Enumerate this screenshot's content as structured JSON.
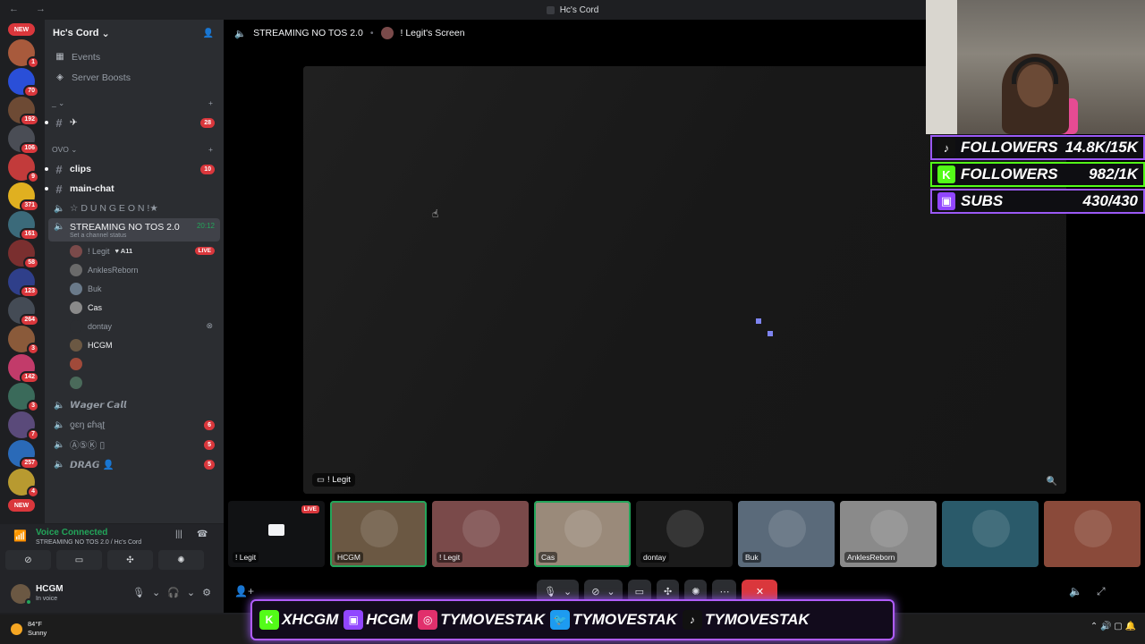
{
  "titlebar": {
    "title": "Hc's Cord",
    "nav": "← →"
  },
  "rail": {
    "new_top": "NEW",
    "new_bottom": "NEW",
    "servers": [
      {
        "badge": "1",
        "color": "#a85a3c"
      },
      {
        "badge": "70",
        "color": "#2a4fd8"
      },
      {
        "badge": "192",
        "color": "#6d4a34"
      },
      {
        "badge": "106",
        "color": "#4a4d55"
      },
      {
        "badge": "9",
        "color": "#c23b3b"
      },
      {
        "badge": "371",
        "color": "#e0b020"
      },
      {
        "badge": "161",
        "color": "#3b6a7a"
      },
      {
        "badge": "58",
        "color": "#7a2f2f"
      },
      {
        "badge": "123",
        "color": "#2f3f8a"
      },
      {
        "badge": "264",
        "color": "#444b55"
      },
      {
        "badge": "3",
        "color": "#8a5a3a"
      },
      {
        "badge": "142",
        "color": "#c23b6a"
      },
      {
        "badge": "3",
        "color": "#3a6a5a"
      },
      {
        "badge": "7",
        "color": "#5a4a7a"
      },
      {
        "badge": "257",
        "color": "#2a6ab8"
      },
      {
        "badge": "4",
        "color": "#b89a30"
      }
    ]
  },
  "sidebar": {
    "guild_name": "Hc's Cord",
    "menu": [
      {
        "label": "Events",
        "icon": "calendar-icon"
      },
      {
        "label": "Server Boosts",
        "icon": "boost-icon"
      }
    ],
    "cat1": "_",
    "chan_plane": {
      "name": "✈",
      "count": "28"
    },
    "cat2": "OVO",
    "channels": [
      {
        "name": "clips",
        "count": "10",
        "bright": true
      },
      {
        "name": "main-chat",
        "bright": true
      },
      {
        "name": "☆ D U N G E O N !★",
        "voice": true
      }
    ],
    "active_channel": {
      "name": "STREAMING NO TOS 2.0",
      "timer": "20:12",
      "status": "Set a channel status"
    },
    "voice_users": [
      {
        "name": "! Legit",
        "extra": "♥ A11",
        "live": "LIVE",
        "color": "#7a4a4a"
      },
      {
        "name": "AnklesReborn",
        "color": "#6a6a6a"
      },
      {
        "name": "Buk",
        "color": "#6a7a8a"
      },
      {
        "name": "Cas",
        "bright": true,
        "color": "#8a8a8a"
      },
      {
        "name": "dontay",
        "xbox": "⊗",
        "color": "#2b2d31"
      },
      {
        "name": "HCGM",
        "bright": true,
        "color": "#6b5843"
      },
      {
        "name": "",
        "color": "#a04a3a"
      },
      {
        "name": "",
        "color": "#4a6a5a"
      }
    ],
    "more_channels": [
      {
        "name": "𝙒𝙖𝙜𝙚𝙧 𝘾𝙖𝙡𝙡"
      },
      {
        "name": "ƍɛŋ ɕɦąʈ",
        "count": "6"
      },
      {
        "name": "Ⓐ⑤Ⓚ ▯",
        "count": "5"
      },
      {
        "name": "𝘿𝙍𝘼𝙂 👤",
        "count": "5"
      }
    ]
  },
  "voice_panel": {
    "status": "Voice Connected",
    "sub": "STREAMING NO TOS 2.0 / Hc's Cord"
  },
  "user_panel": {
    "name": "HCGM",
    "sub": "In voice"
  },
  "call": {
    "header_channel": "STREAMING NO TOS 2.0",
    "header_screen": "! Legit's Screen",
    "stream_label": "! Legit",
    "tiles": [
      {
        "name": "! Legit",
        "live": "LIVE",
        "type": "screen"
      },
      {
        "name": "HCGM",
        "speaking": true,
        "color": "#6b5843"
      },
      {
        "name": "! Legit",
        "color": "#7a4a4a"
      },
      {
        "name": "Cas",
        "speaking": true,
        "color": "#9a8a7a"
      },
      {
        "name": "dontay",
        "color": "#1b1b1b"
      },
      {
        "name": "Buk",
        "color": "#5a6a7a"
      },
      {
        "name": "AnklesReborn",
        "color": "#8a8a8a"
      },
      {
        "name": "",
        "color": "#2a5a6a"
      },
      {
        "name": "",
        "color": "#8a4a3a"
      }
    ]
  },
  "overlay": {
    "stats": [
      {
        "label": "FOLLOWERS",
        "value": "14.8K/15K",
        "platform": "tiktok-icon",
        "logo": "♪",
        "logo_bg": "#111"
      },
      {
        "label": "FOLLOWERS",
        "value": "982/1K",
        "platform": "kick-icon",
        "logo": "K",
        "logo_bg": "#53fc18"
      },
      {
        "label": "SUBS",
        "value": "430/430",
        "platform": "twitch-icon",
        "logo": "▣",
        "logo_bg": "#9146ff"
      }
    ],
    "handles": [
      {
        "text": "XHCGM",
        "logo": "K",
        "bg": "#53fc18",
        "icon": "kick-icon"
      },
      {
        "text": "HCGM",
        "logo": "▣",
        "bg": "#9146ff",
        "icon": "twitch-icon"
      },
      {
        "text": "TYMOVESTAK",
        "logo": "◎",
        "bg": "#e1306c",
        "icon": "instagram-icon"
      },
      {
        "text": "TYMOVESTAK",
        "logo": "🐦",
        "bg": "#1d9bf0",
        "icon": "twitter-icon"
      },
      {
        "text": "TYMOVESTAK",
        "logo": "♪",
        "bg": "#111",
        "icon": "tiktok-icon"
      }
    ]
  },
  "taskbar": {
    "temp": "84°F",
    "cond": "Sunny",
    "tray": "⌃  🔊  ▢  🔔"
  }
}
